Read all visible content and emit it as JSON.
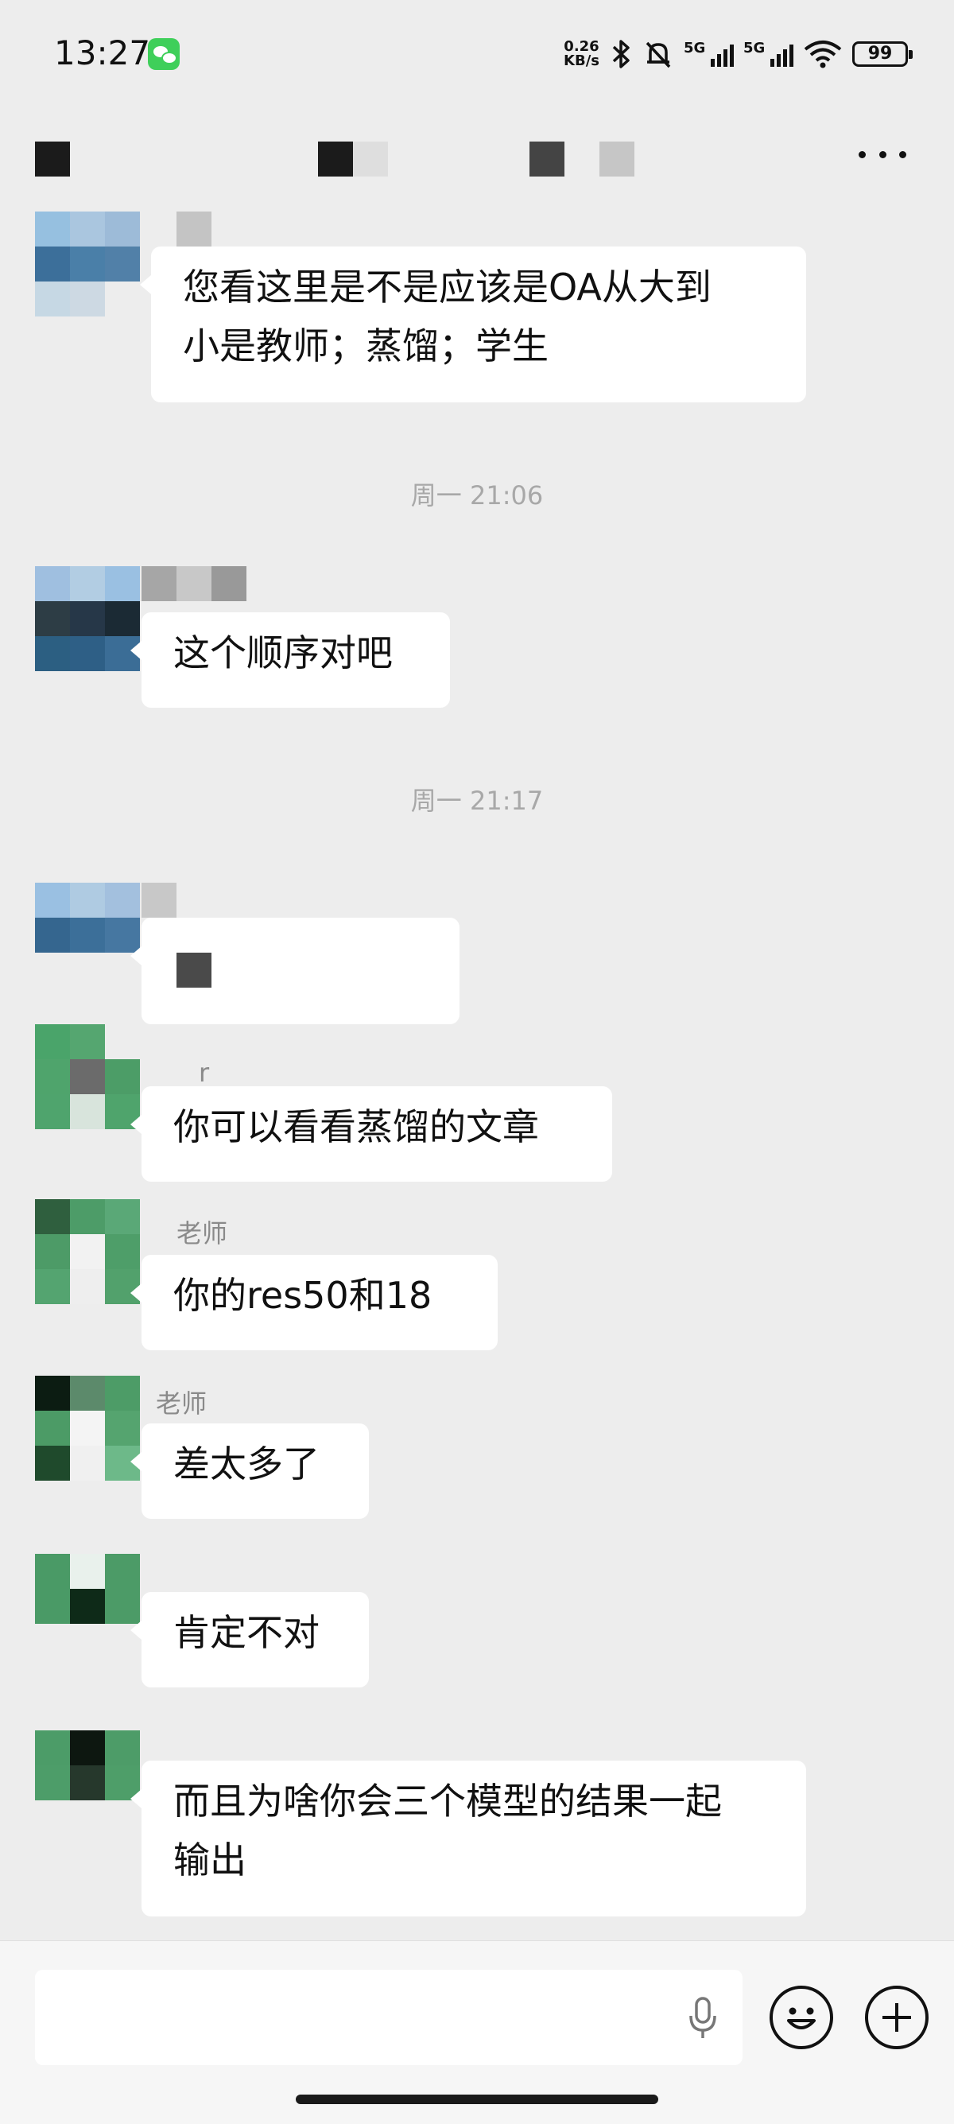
{
  "status_bar": {
    "time": "13:27",
    "net_speed_value": "0.26",
    "net_speed_unit": "KB/s",
    "network_1": "5G",
    "network_2": "5G",
    "battery": "99",
    "icons": [
      "wechat-notification-icon",
      "bluetooth-icon",
      "mute-icon",
      "signal-icon",
      "signal-icon",
      "wifi-icon",
      "battery-icon"
    ]
  },
  "header": {
    "more_icon": "more-icon"
  },
  "messages": [
    {
      "type": "text",
      "sender_name": "",
      "text_lines": [
        "您看这里是不是应该是OA从大到",
        "小是教师；蒸馏；学生"
      ]
    },
    {
      "type": "time",
      "text": "周一 21:06"
    },
    {
      "type": "text",
      "sender_name": "",
      "text_lines": [
        "这个顺序对吧"
      ]
    },
    {
      "type": "time",
      "text": "周一 21:17"
    },
    {
      "type": "text",
      "sender_name": "",
      "text_lines": [
        ""
      ]
    },
    {
      "type": "text",
      "sender_name": "r",
      "text_lines": [
        "你可以看看蒸馏的文章"
      ]
    },
    {
      "type": "text",
      "sender_name": "老师",
      "text_lines": [
        "你的res50和18"
      ]
    },
    {
      "type": "text",
      "sender_name": "老师",
      "text_lines": [
        "差太多了"
      ]
    },
    {
      "type": "text",
      "sender_name": "",
      "text_lines": [
        "肯定不对"
      ]
    },
    {
      "type": "text",
      "sender_name": "",
      "text_lines": [
        "而且为啥你会三个模型的结果一起",
        "输出"
      ]
    }
  ],
  "input_bar": {
    "value": "",
    "icons": [
      "voice-icon",
      "emoji-icon",
      "plus-icon"
    ]
  }
}
